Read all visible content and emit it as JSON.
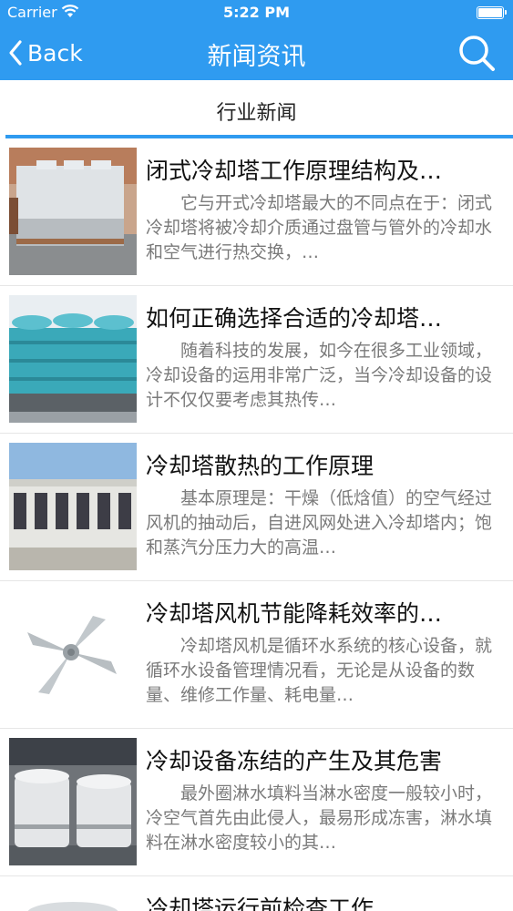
{
  "status_bar": {
    "carrier": "Carrier",
    "time": "5:22 PM"
  },
  "nav": {
    "back_label": "Back",
    "title": "新闻资讯"
  },
  "section": {
    "label": "行业新闻"
  },
  "colors": {
    "accent": "#2f9bf0"
  },
  "articles": [
    {
      "title": "闭式冷却塔工作原理结构及…",
      "summary": "它与开式冷却塔最大的不同点在于：闭式冷却塔将被冷却介质通过盘管与管外的冷却水和空气进行热交换，…",
      "thumb": "closed-cooling-tower-photo"
    },
    {
      "title": "如何正确选择合适的冷却塔…",
      "summary": "随着科技的发展，如今在很多工业领域，冷却设备的运用非常广泛，当今冷却设备的设计不仅仅要考虑其热传…",
      "thumb": "blue-cooling-tower-photo"
    },
    {
      "title": "冷却塔散热的工作原理",
      "summary": "基本原理是：干燥（低焓值）的空气经过风机的抽动后，自进风网处进入冷却塔内；饱和蒸汽分压力大的高温…",
      "thumb": "rooftop-cooling-towers-photo"
    },
    {
      "title": "冷却塔风机节能降耗效率的…",
      "summary": "冷却塔风机是循环水系统的核心设备，就循环水设备管理情况看，无论是从设备的数量、维修工作量、耗电量…",
      "thumb": "fan-blade-photo"
    },
    {
      "title": "冷却设备冻结的产生及其危害",
      "summary": "最外圈淋水填料当淋水密度一般较小时，冷空气首先由此侵人，最易形成冻害，淋水填料在淋水密度较小的其…",
      "thumb": "round-cooling-towers-photo"
    },
    {
      "title": "冷却塔运行前检查工作",
      "summary": "",
      "thumb": "cooling-tower-photo"
    }
  ]
}
